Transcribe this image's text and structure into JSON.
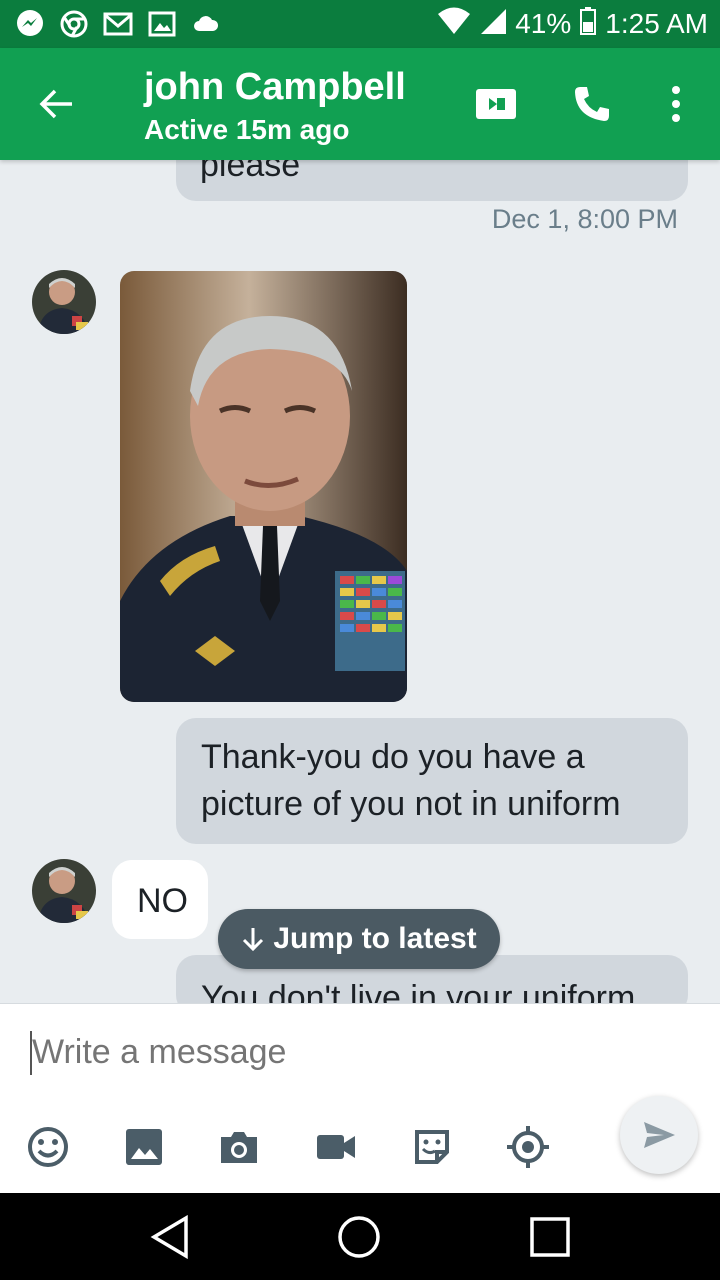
{
  "status_bar": {
    "battery": "41%",
    "time": "1:25 AM"
  },
  "header": {
    "contact_name": "john Campbell",
    "status": "Active 15m ago"
  },
  "messages": {
    "partial_top": "please",
    "timestamp": "Dec 1, 8:00 PM",
    "outgoing_1": "Thank-you do you have a picture of you not in uniform",
    "incoming_1": "NO",
    "outgoing_2_partial": "You don't live in your uniform"
  },
  "jump_to_latest": "Jump to latest",
  "composer": {
    "placeholder": "Write a message"
  },
  "colors": {
    "status_bar": "#0b7d3e",
    "app_bar": "#11a052",
    "background": "#e9edf0",
    "outgoing_bubble": "#d1d7dd"
  }
}
